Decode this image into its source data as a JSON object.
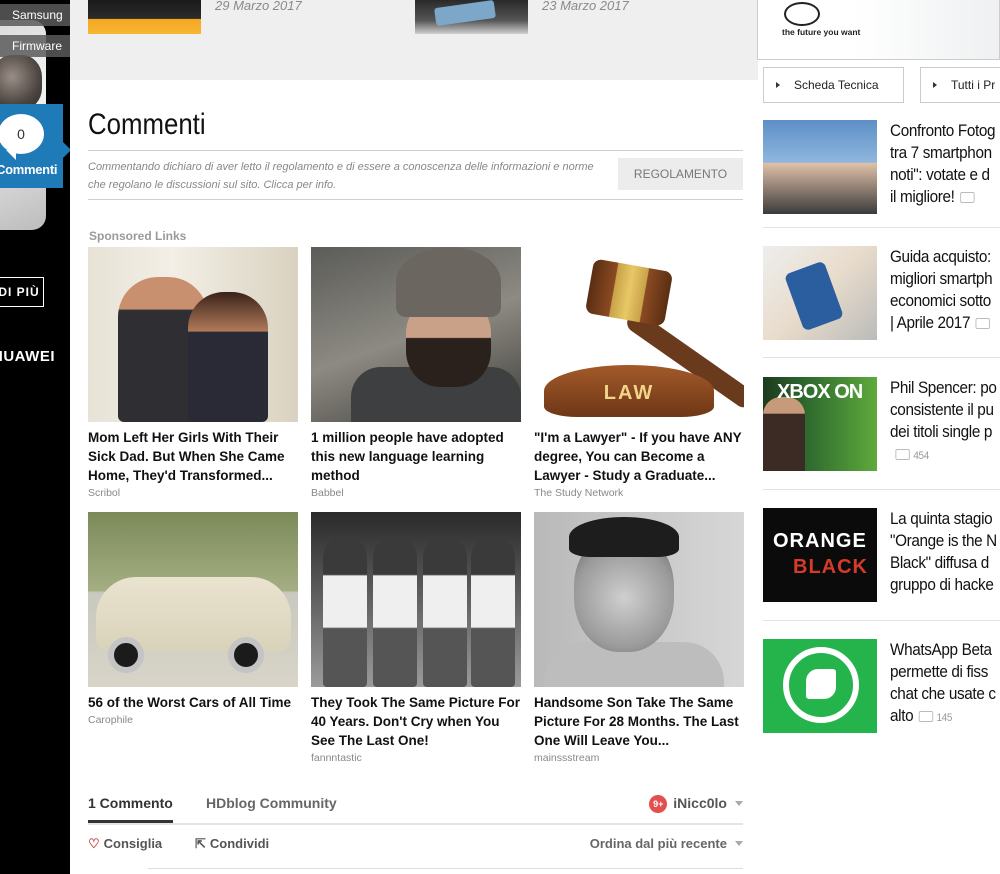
{
  "left": {
    "tags": [
      "Samsung",
      "Firmware"
    ],
    "comments_count": "0",
    "comments_label": "Commenti",
    "more_label": "DI PIÙ",
    "brand": "HUAWEI"
  },
  "top_news": {
    "dates": [
      "29 Marzo 2017",
      "23 Marzo 2017"
    ]
  },
  "comments": {
    "title": "Commenti",
    "disclaimer": "Commentando dichiaro di aver letto il regolamento e di essere a conoscenza delle informazioni e norme che regolano le discussioni sul sito. Clicca per info.",
    "rules_button": "REGOLAMENTO"
  },
  "sponsored": {
    "label": "Sponsored Links",
    "ads": [
      {
        "title": "Mom Left Her Girls With Their Sick Dad. But When She Came Home, They'd Transformed...",
        "source": "Scribol"
      },
      {
        "title": "1 million people have adopted this new language learning method",
        "source": "Babbel"
      },
      {
        "title": "\"I'm a Lawyer\" - If you have ANY degree, You can Become a Lawyer - Study a Graduate...",
        "source": "The Study Network",
        "image_text": "LAW"
      },
      {
        "title": "56 of the Worst Cars of All Time",
        "source": "Carophile"
      },
      {
        "title": "They Took The Same Picture For 40 Years. Don't Cry when You See The Last One!",
        "source": "fannntastic"
      },
      {
        "title": "Handsome Son Take The Same Picture For 28 Months. The Last One Will Leave You...",
        "source": "mainssstream"
      }
    ]
  },
  "disqus": {
    "tab_comments": "1 Commento",
    "tab_community": "HDblog Community",
    "notif_count": "9+",
    "username": "iNicc0lo",
    "recommend": "Consiglia",
    "share": "Condividi",
    "sort": "Ordina dal più recente"
  },
  "sidebar": {
    "logo_text": "the future you want",
    "buttons": [
      "Scheda Tecnica",
      "Tutti i Pr"
    ],
    "items": [
      {
        "lines": [
          "Confronto Fotog",
          "tra 7 smartphon",
          "noti\": votate e d",
          "il migliore!"
        ],
        "count": ""
      },
      {
        "lines": [
          "Guida acquisto:",
          "migliori smartph",
          "economici sotto",
          "| Aprile 2017"
        ],
        "count": ""
      },
      {
        "lines": [
          "Phil Spencer: po",
          "consistente il pu",
          "dei titoli single p"
        ],
        "count": "454"
      },
      {
        "lines": [
          "La quinta stagio",
          "\"Orange is the N",
          "Black\" diffusa d",
          "gruppo di hacke"
        ],
        "count": ""
      },
      {
        "lines": [
          "WhatsApp Beta",
          "permette di fiss",
          "chat che usate c",
          "alto"
        ],
        "count": "145"
      }
    ],
    "thumb_texts": [
      "XBOX ON",
      "ORANGE",
      "BLACK"
    ]
  },
  "colors": {
    "accent_blue": "#1f7ab8",
    "notif_red": "#e14f4f",
    "whatsapp_green": "#25b34c"
  }
}
